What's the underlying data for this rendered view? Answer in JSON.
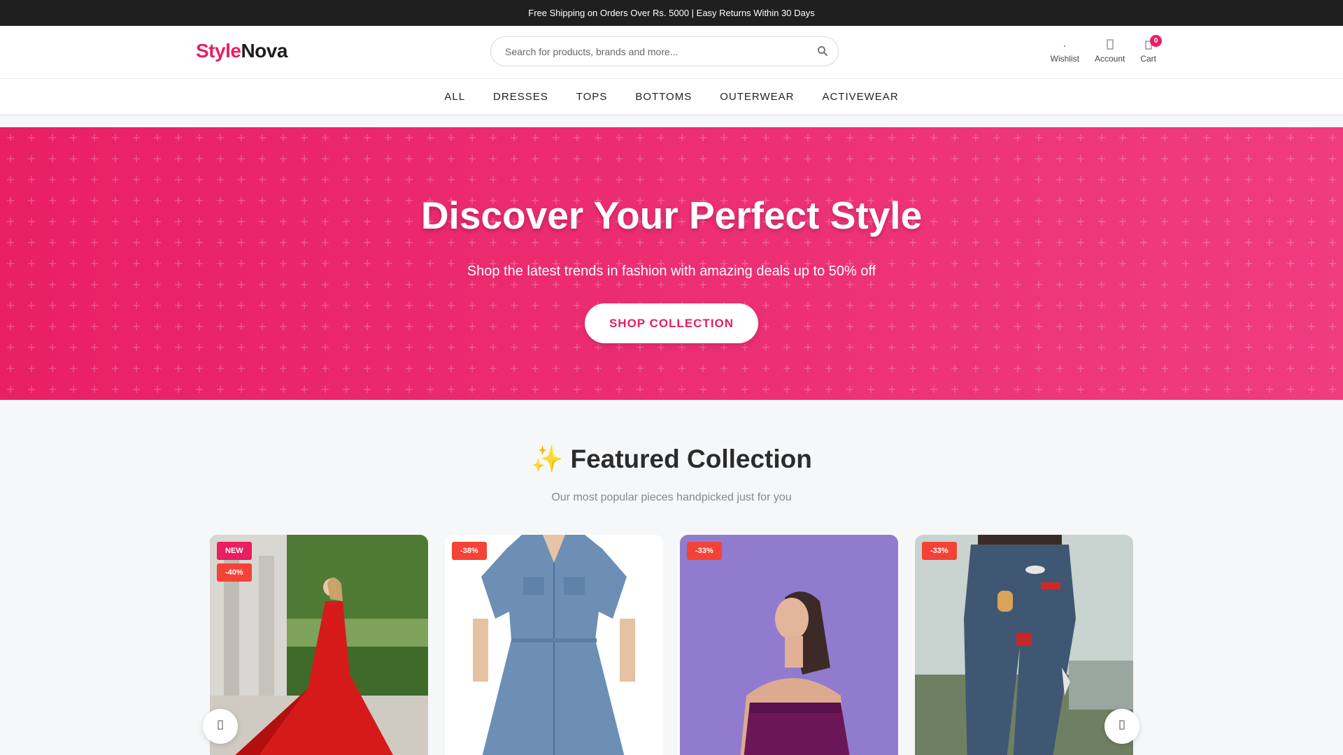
{
  "announcement": "Free Shipping on Orders Over Rs. 5000 | Easy Returns Within 30 Days",
  "brand": {
    "part1": "Style",
    "part2": "Nova",
    "accent_color": "#e91e63"
  },
  "search": {
    "placeholder": "Search for products, brands and more...",
    "icon": "search-icon"
  },
  "header_actions": {
    "wishlist": {
      "label": "Wishlist",
      "icon": "heart-icon"
    },
    "account": {
      "label": "Account",
      "icon": "user-icon"
    },
    "cart": {
      "label": "Cart",
      "icon": "shopping-bag-icon",
      "count": "0"
    }
  },
  "nav": [
    "ALL",
    "DRESSES",
    "TOPS",
    "BOTTOMS",
    "OUTERWEAR",
    "ACTIVEWEAR"
  ],
  "hero": {
    "title": "Discover Your Perfect Style",
    "subtitle": "Shop the latest trends in fashion with amazing deals up to 50% off",
    "cta": "SHOP COLLECTION",
    "color": "#e91e63"
  },
  "featured": {
    "title": "✨ Featured Collection",
    "subtitle": "Our most popular pieces handpicked just for you"
  },
  "products": [
    {
      "badges": [
        {
          "text": "NEW",
          "color": "#e91e63"
        },
        {
          "text": "-40%",
          "color": "#f44336"
        }
      ],
      "image": "red-gown-photo"
    },
    {
      "badges": [
        {
          "text": "-38%",
          "color": "#f44336"
        }
      ],
      "image": "denim-dress-photo"
    },
    {
      "badges": [
        {
          "text": "-33%",
          "color": "#f44336"
        }
      ],
      "image": "purple-top-photo"
    },
    {
      "badges": [
        {
          "text": "-33%",
          "color": "#f44336"
        }
      ],
      "image": "patched-jeans-photo"
    }
  ],
  "carousel": {
    "prev_icon": "chevron-left-icon",
    "next_icon": "chevron-right-icon"
  }
}
